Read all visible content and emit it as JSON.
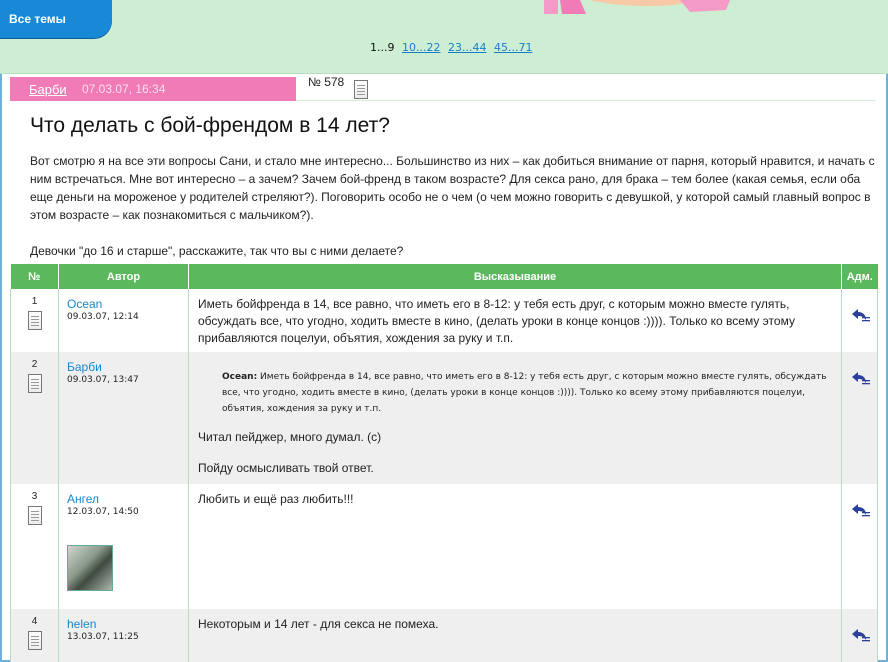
{
  "nav": {
    "all_topics": "Все темы",
    "pagination": {
      "current": "1...9",
      "links": [
        "10...22",
        "23...44",
        "45...71"
      ]
    }
  },
  "post": {
    "author": "Барби",
    "date": "07.03.07, 16:34",
    "number": "№ 578",
    "title": "Что делать с бой-френдом в 14 лет?",
    "paragraphs": [
      "Вот смотрю я на все эти вопросы Сани, и стало мне интересно... Большинство из них – как добиться внимание от парня, который нравится, и начать с ним встречаться. Мне вот интересно – а зачем? Зачем бой-френд в таком возрасте? Для секса рано, для брака – тем более (какая семья, если оба еще деньги на мороженое у родителей стреляют?). Поговорить особо не о чем (о чем можно говорить с девушкой, у которой самый главный вопрос в этом возрасте – как познакомиться с мальчиком?).",
      "Девочки \"до 16 и старше\", расскажите, так что вы с ними делаете?"
    ]
  },
  "table": {
    "headers": {
      "num": "№",
      "author": "Автор",
      "message": "Высказывание",
      "adm": "Адм."
    },
    "rows": [
      {
        "num": "1",
        "author": "Ocean",
        "date": "09.03.07, 12:14",
        "text": "Иметь бойфренда в 14, все равно, что иметь его в 8-12: у тебя есть друг, с которым можно вместе гулять, обсуждать все, что угодно, ходить вместе в кино, (делать уроки в конце концов :)))). Только ко всему этому прибавляются поцелуи, объятия, хождения за руку и т.п."
      },
      {
        "num": "2",
        "author": "Барби",
        "date": "09.03.07, 13:47",
        "quote_author": "Ocean:",
        "quote_text": "Иметь бойфренда в 14, все равно, что иметь его в 8-12: у тебя есть друг, с которым можно вместе гулять, обсуждать все, что угодно, ходить вместе в кино, (делать уроки в конце концов :)))). Только ко всему этому прибавляются поцелуи, объятия, хождения за руку и т.п.",
        "text1": "Читал пейджер, много думал. (с)",
        "text2": "Пойду осмысливать твой ответ."
      },
      {
        "num": "3",
        "author": "Ангел",
        "date": "12.03.07, 14:50",
        "text": "Любить и ещё раз любить!!!"
      },
      {
        "num": "4",
        "author": "helen",
        "date": "13.03.07, 11:25",
        "text": "Некоторым и 14 лет - для секса не помеха."
      }
    ]
  },
  "icons": {
    "doc": "document-icon",
    "reply": "reply-icon"
  },
  "colors": {
    "green_band": "#cdeed3",
    "blue_tab": "#1889d6",
    "pink_bar": "#f07bb6",
    "table_header": "#5cb85c",
    "link": "#1a86c9"
  }
}
